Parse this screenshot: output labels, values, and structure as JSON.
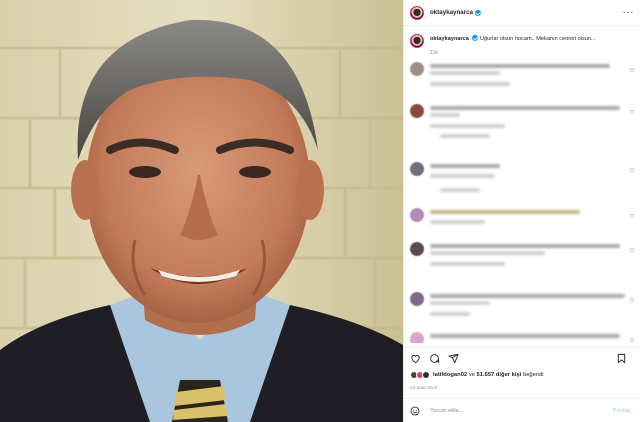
{
  "post": {
    "username": "oktaykaynarca",
    "verified": true,
    "caption_username": "oktaykaynarca",
    "caption_text": "Uğurlar olsun hocam.. Mekanın cennet olsun...",
    "caption_time": "13s"
  },
  "likes": {
    "liker": "latifdogan02",
    "connector": "ve",
    "others": "51.657 diğer kişi",
    "suffix": "beğendi"
  },
  "post_time": "13 saat önce",
  "comment_box": {
    "placeholder": "Yorum ekle...",
    "post_label": "Paylaş"
  },
  "icons": {
    "more": "more-icon",
    "heart": "heart-icon",
    "comment": "comment-icon",
    "share": "share-icon",
    "save": "bookmark-icon",
    "emoji": "emoji-icon"
  },
  "colors": {
    "verified": "#0095f6",
    "secondary_text": "#8e8e8e",
    "post_button": "#b2dffc"
  }
}
